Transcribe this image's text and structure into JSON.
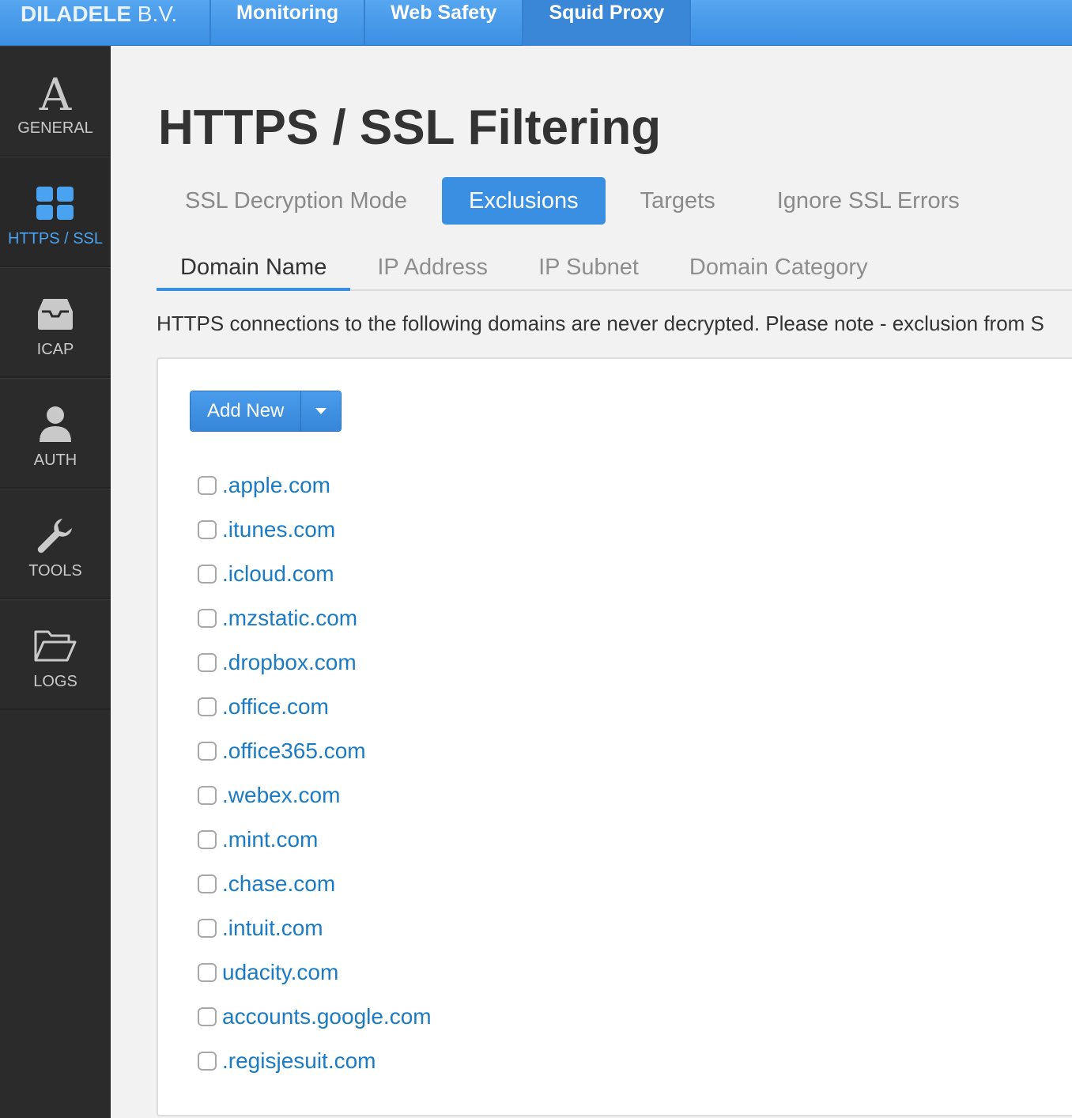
{
  "brand": {
    "name": "DILADELE",
    "suffix": " B.V."
  },
  "topnav": [
    {
      "label": "Monitoring"
    },
    {
      "label": "Web Safety"
    },
    {
      "label": "Squid Proxy"
    }
  ],
  "sidebar": [
    {
      "label": "GENERAL",
      "icon": "letter-a-icon"
    },
    {
      "label": "HTTPS / SSL",
      "icon": "grid-tiles-icon"
    },
    {
      "label": "ICAP",
      "icon": "inbox-icon"
    },
    {
      "label": "AUTH",
      "icon": "user-icon"
    },
    {
      "label": "TOOLS",
      "icon": "wrench-icon"
    },
    {
      "label": "LOGS",
      "icon": "folder-open-icon"
    }
  ],
  "page": {
    "title": "HTTPS / SSL Filtering"
  },
  "pills": [
    {
      "label": "SSL Decryption Mode"
    },
    {
      "label": "Exclusions"
    },
    {
      "label": "Targets"
    },
    {
      "label": "Ignore SSL Errors"
    }
  ],
  "subtabs": [
    {
      "label": "Domain Name"
    },
    {
      "label": "IP Address"
    },
    {
      "label": "IP Subnet"
    },
    {
      "label": "Domain Category"
    }
  ],
  "note": "HTTPS connections to the following domains are never decrypted. Please note - exclusion from S",
  "add_button": {
    "label": "Add New"
  },
  "domains": [
    ".apple.com",
    ".itunes.com",
    ".icloud.com",
    ".mzstatic.com",
    ".dropbox.com",
    ".office.com",
    ".office365.com",
    ".webex.com",
    ".mint.com",
    ".chase.com",
    ".intuit.com",
    "udacity.com",
    "accounts.google.com",
    ".regisjesuit.com"
  ],
  "colors": {
    "accent": "#3b8fe3",
    "link": "#1a7bc4",
    "sidebar": "#2b2b2b",
    "sidebar_active_text": "#4aa3f0"
  }
}
